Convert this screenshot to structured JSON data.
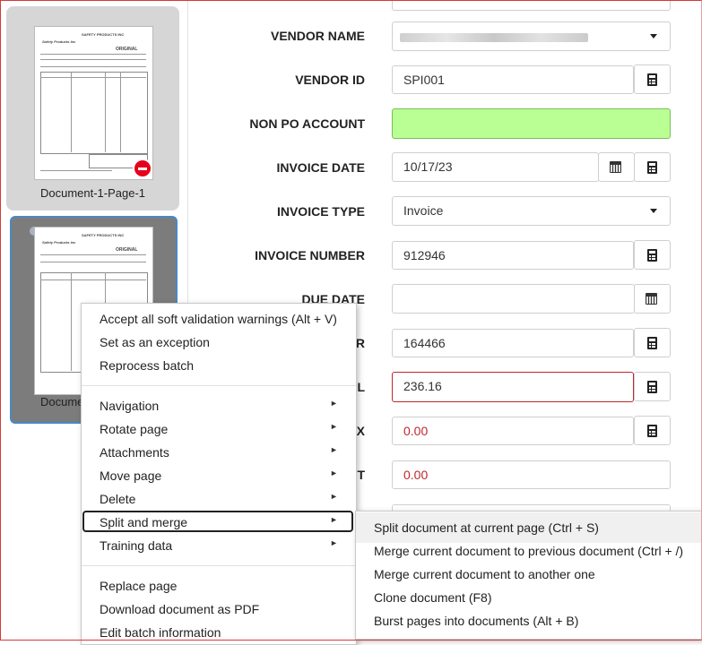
{
  "thumbnails": [
    {
      "label": "Document-1-Page-1",
      "selected": false,
      "has_remove": true
    },
    {
      "label": "Docume",
      "selected": true,
      "has_remove": false
    }
  ],
  "thumb_doc": {
    "company": "SAFETY PRODUCTS INC",
    "stamp": "ORIGINAL",
    "logo": "Safety Products Inc"
  },
  "form": {
    "vendor_name": {
      "label": "VENDOR NAME",
      "value": ""
    },
    "vendor_id": {
      "label": "VENDOR ID",
      "value": "SPI001"
    },
    "non_po_account": {
      "label": "NON PO ACCOUNT",
      "value": ""
    },
    "invoice_date": {
      "label": "INVOICE DATE",
      "value": "10/17/23"
    },
    "invoice_type": {
      "label": "INVOICE TYPE",
      "value": "Invoice"
    },
    "invoice_number": {
      "label": "INVOICE NUMBER",
      "value": "912946"
    },
    "due_date": {
      "label": "DUE DATE",
      "value": ""
    },
    "po_number": {
      "label": "R",
      "value": "164466"
    },
    "total": {
      "label": "L",
      "value": "236.16"
    },
    "tax": {
      "label": "X",
      "value": "0.00"
    },
    "freight": {
      "label": "T",
      "value": "0.00"
    }
  },
  "context_menu": {
    "group1": [
      "Accept all soft validation warnings (Alt + V)",
      "Set as an exception",
      "Reprocess batch"
    ],
    "group2": [
      "Navigation",
      "Rotate page",
      "Attachments",
      "Move page",
      "Delete",
      "Split and merge",
      "Training data"
    ],
    "group3": [
      "Replace page",
      "Download document as PDF",
      "Edit batch information"
    ],
    "submenu_arrow": "►"
  },
  "submenu": [
    "Split document at current page (Ctrl + S)",
    "Merge current document to previous document (Ctrl + /)",
    "Merge current document to another one",
    "Clone document (F8)",
    "Burst pages into documents (Alt + B)"
  ],
  "colors": {
    "green_field": "#baff93",
    "error_border": "#c0262d",
    "selected_border": "#4a88c7",
    "remove": "#e6001a"
  }
}
